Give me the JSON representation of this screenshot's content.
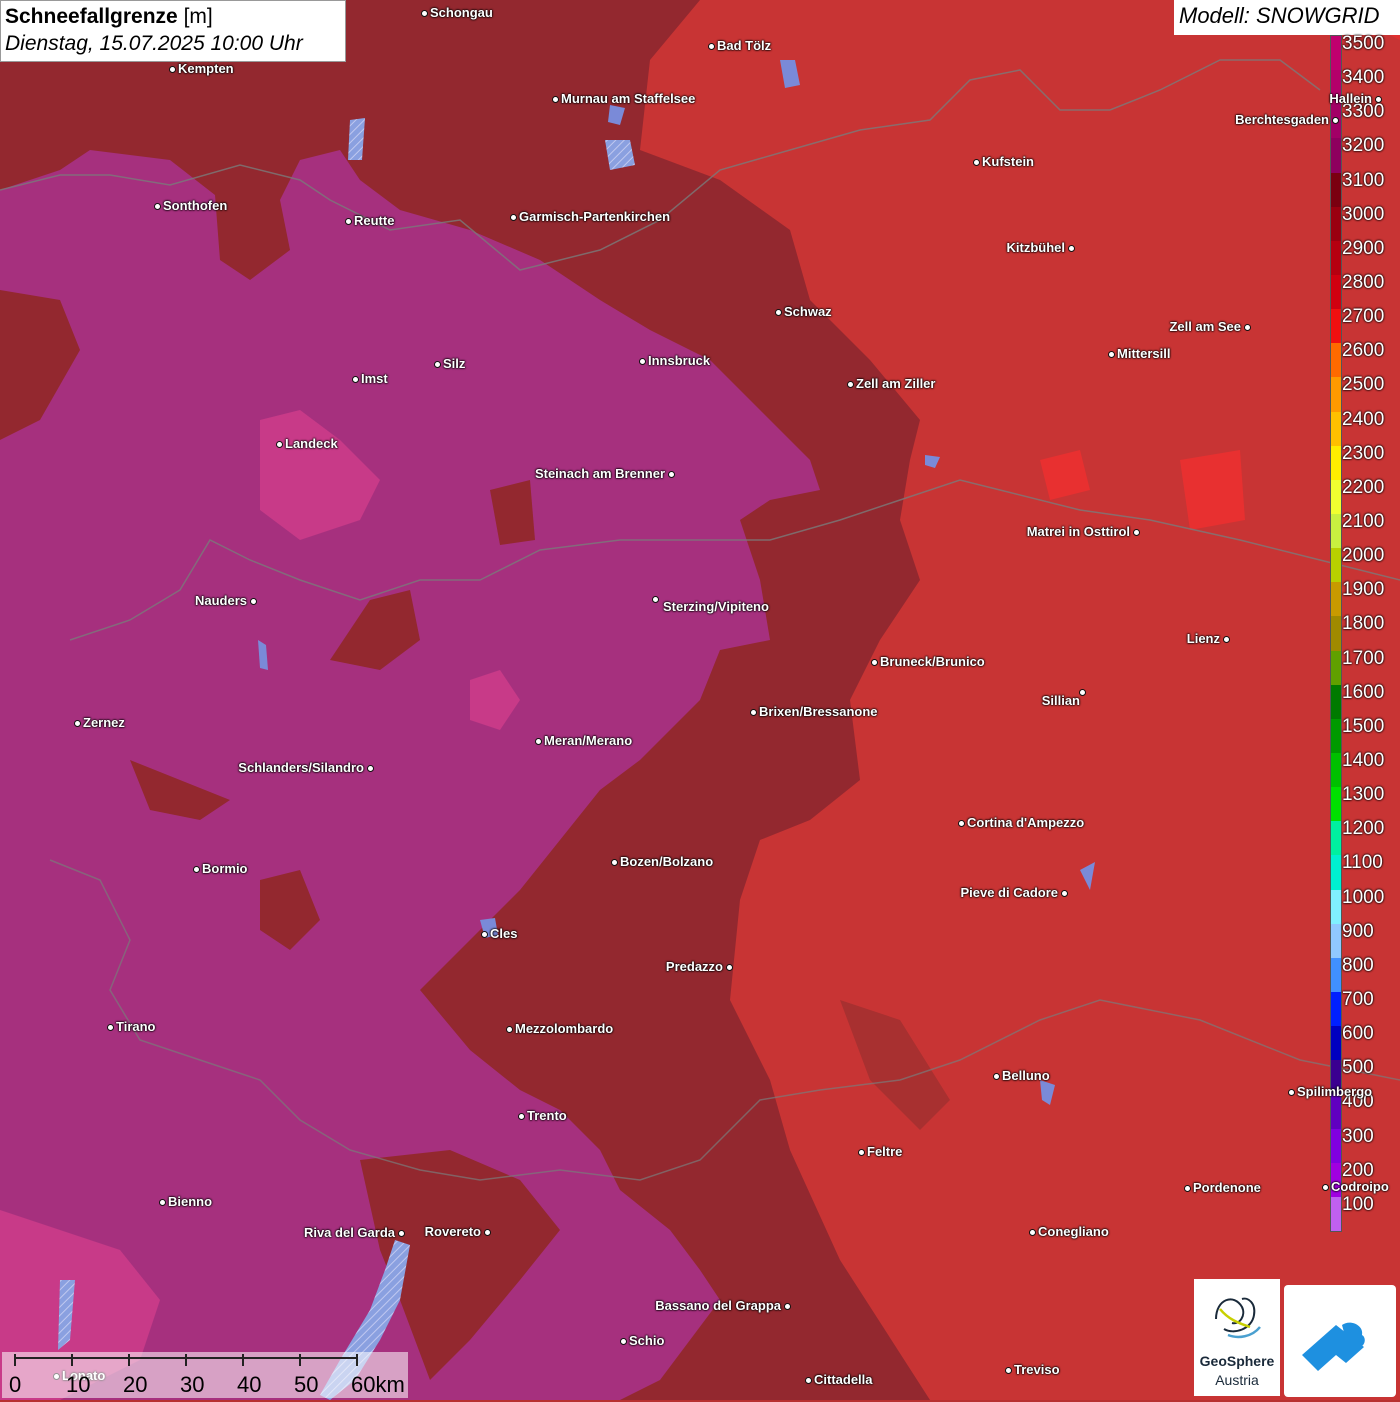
{
  "title": {
    "main": "Schneefallgrenze",
    "unit": "[m]",
    "datetime": "Dienstag, 15.07.2025 10:00 Uhr"
  },
  "model": "Modell: SNOWGRID",
  "legend": {
    "labels": [
      "3500",
      "3400",
      "3300",
      "3200",
      "3100",
      "3000",
      "2900",
      "2800",
      "2700",
      "2600",
      "2500",
      "2400",
      "2300",
      "2200",
      "2100",
      "2000",
      "1900",
      "1800",
      "1700",
      "1600",
      "1500",
      "1400",
      "1300",
      "1200",
      "1100",
      "1000",
      "900",
      "800",
      "700",
      "600",
      "500",
      "400",
      "300",
      "200",
      "100"
    ],
    "colors": [
      "#c0006e",
      "#b4006a",
      "#a20066",
      "#8e005e",
      "#7a0010",
      "#9a0010",
      "#b50010",
      "#d00010",
      "#f01010",
      "#ff6a00",
      "#ff9a00",
      "#ffc000",
      "#ffee00",
      "#f0ff30",
      "#c8f040",
      "#b8d000",
      "#c89a00",
      "#a08a00",
      "#60a000",
      "#007a00",
      "#009a00",
      "#00c000",
      "#00e000",
      "#00f0a0",
      "#00f0d0",
      "#80f0ff",
      "#90c8ff",
      "#4090ff",
      "#0020ff",
      "#0000c0",
      "#3a0090",
      "#6000c0",
      "#8000e0",
      "#a000e0",
      "#c060f0"
    ]
  },
  "cities": [
    {
      "name": "Schongau"
    },
    {
      "name": "Bad Tölz"
    },
    {
      "name": "Kempten"
    },
    {
      "name": "Murnau am Staffelsee"
    },
    {
      "name": "Hallein"
    },
    {
      "name": "Berchtesgaden"
    },
    {
      "name": "Kufstein"
    },
    {
      "name": "Sonthofen"
    },
    {
      "name": "Reutte"
    },
    {
      "name": "Garmisch-Partenkirchen"
    },
    {
      "name": "Kitzbühel"
    },
    {
      "name": "Schwaz"
    },
    {
      "name": "Zell am See"
    },
    {
      "name": "Mittersill"
    },
    {
      "name": "Innsbruck"
    },
    {
      "name": "Imst"
    },
    {
      "name": "Silz"
    },
    {
      "name": "Zell am Ziller"
    },
    {
      "name": "Landeck"
    },
    {
      "name": "Steinach am Brenner"
    },
    {
      "name": "Matrei in Osttirol"
    },
    {
      "name": "Nauders"
    },
    {
      "name": "Sterzing/Vipiteno"
    },
    {
      "name": "Lienz"
    },
    {
      "name": "Bruneck/Brunico"
    },
    {
      "name": "Sillian"
    },
    {
      "name": "Brixen/Bressanone"
    },
    {
      "name": "Zernez"
    },
    {
      "name": "Meran/Merano"
    },
    {
      "name": "Schlanders/Silandro"
    },
    {
      "name": "Cortina d'Ampezzo"
    },
    {
      "name": "Bormio"
    },
    {
      "name": "Bozen/Bolzano"
    },
    {
      "name": "Pieve di Cadore"
    },
    {
      "name": "Cles"
    },
    {
      "name": "Predazzo"
    },
    {
      "name": "Tirano"
    },
    {
      "name": "Mezzolombardo"
    },
    {
      "name": "Belluno"
    },
    {
      "name": "Spilimbergo"
    },
    {
      "name": "Trento"
    },
    {
      "name": "Feltre"
    },
    {
      "name": "Pordenone"
    },
    {
      "name": "Codroipo"
    },
    {
      "name": "Bienno"
    },
    {
      "name": "Riva del Garda"
    },
    {
      "name": "Rovereto"
    },
    {
      "name": "Conegliano"
    },
    {
      "name": "Bassano del Grappa"
    },
    {
      "name": "Schio"
    },
    {
      "name": "Treviso"
    },
    {
      "name": "Cittadella"
    },
    {
      "name": "Lonato"
    }
  ],
  "scale": {
    "labels": [
      "0",
      "10",
      "20",
      "30",
      "40",
      "50",
      "60km"
    ]
  },
  "logos": {
    "geosphere_line1": "GeoSphere",
    "geosphere_line2": "Austria"
  }
}
